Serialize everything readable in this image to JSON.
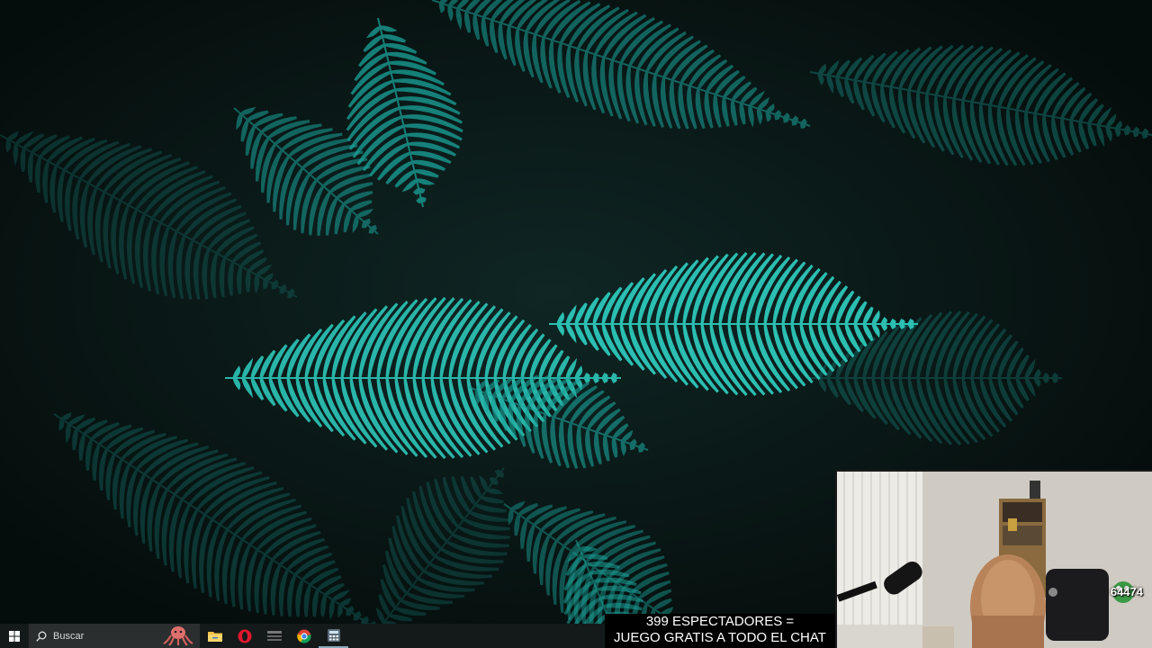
{
  "taskbar": {
    "search_placeholder": "Buscar",
    "icons": [
      "windows-start-icon",
      "search-icon",
      "octopus-icon",
      "file-explorer-icon",
      "opera-icon",
      "app-icon",
      "chrome-icon",
      "calculator-icon"
    ]
  },
  "stream": {
    "caption_line1": "399 ESPECTADORES =",
    "caption_line2": "JUEGO GRATIS A TODO EL CHAT",
    "webcam_badge": "64474"
  },
  "colors": {
    "fern": "#1aa39a",
    "fern_bright": "#2fd0c2",
    "background": "#071312",
    "taskbar": "#141a1a"
  }
}
